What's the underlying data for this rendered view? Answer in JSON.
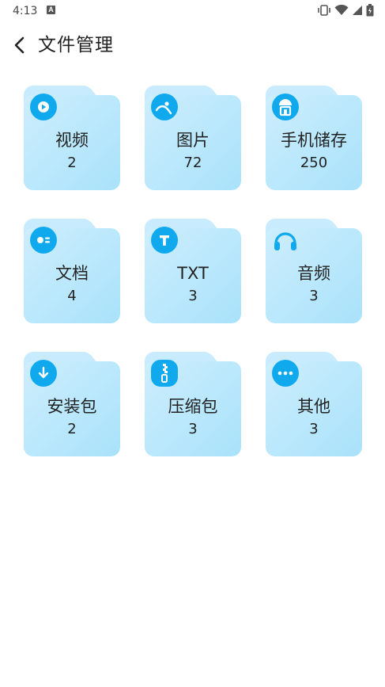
{
  "status_bar": {
    "time": "4:13",
    "notification_badge": "A"
  },
  "header": {
    "title": "文件管理"
  },
  "colors": {
    "accent": "#10a9ee",
    "card_light": "#cdeefd",
    "card_dark": "#a9e2fb"
  },
  "categories": [
    {
      "label": "视频",
      "count": "2",
      "icon": "video-play-icon"
    },
    {
      "label": "图片",
      "count": "72",
      "icon": "image-icon"
    },
    {
      "label": "手机储存",
      "count": "250",
      "icon": "storage-icon"
    },
    {
      "label": "文档",
      "count": "4",
      "icon": "document-icon"
    },
    {
      "label": "TXT",
      "count": "3",
      "icon": "txt-icon"
    },
    {
      "label": "音频",
      "count": "3",
      "icon": "headphones-icon"
    },
    {
      "label": "安装包",
      "count": "2",
      "icon": "download-icon"
    },
    {
      "label": "压缩包",
      "count": "3",
      "icon": "zip-icon"
    },
    {
      "label": "其他",
      "count": "3",
      "icon": "more-icon"
    }
  ]
}
